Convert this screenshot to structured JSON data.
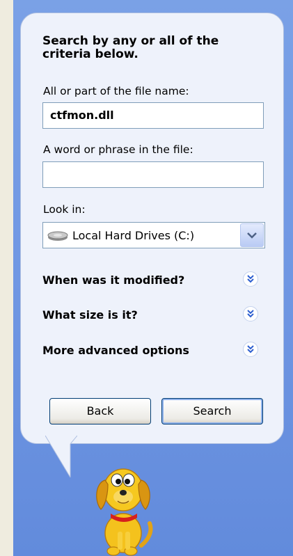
{
  "heading": "Search by any or all of the criteria below.",
  "file_name": {
    "label": "All or part of the file name:",
    "value": "ctfmon.dll"
  },
  "phrase": {
    "label": "A word or phrase in the file:",
    "value": ""
  },
  "look_in": {
    "label": "Look in:",
    "value": "Local Hard Drives (C:)",
    "icon": "hard-drive-icon"
  },
  "sections": [
    {
      "label": "When was it modified?",
      "icon": "expand-chevron-icon"
    },
    {
      "label": "What size is it?",
      "icon": "expand-chevron-icon"
    },
    {
      "label": "More advanced options",
      "icon": "expand-chevron-icon"
    }
  ],
  "buttons": {
    "back": "Back",
    "search": "Search"
  },
  "assistant": {
    "icon": "search-dog-icon"
  },
  "colors": {
    "pane": "#7097e3",
    "bubble": "#eef2fb",
    "button_border": "#003c74",
    "chevron": "#2d5fd0"
  }
}
